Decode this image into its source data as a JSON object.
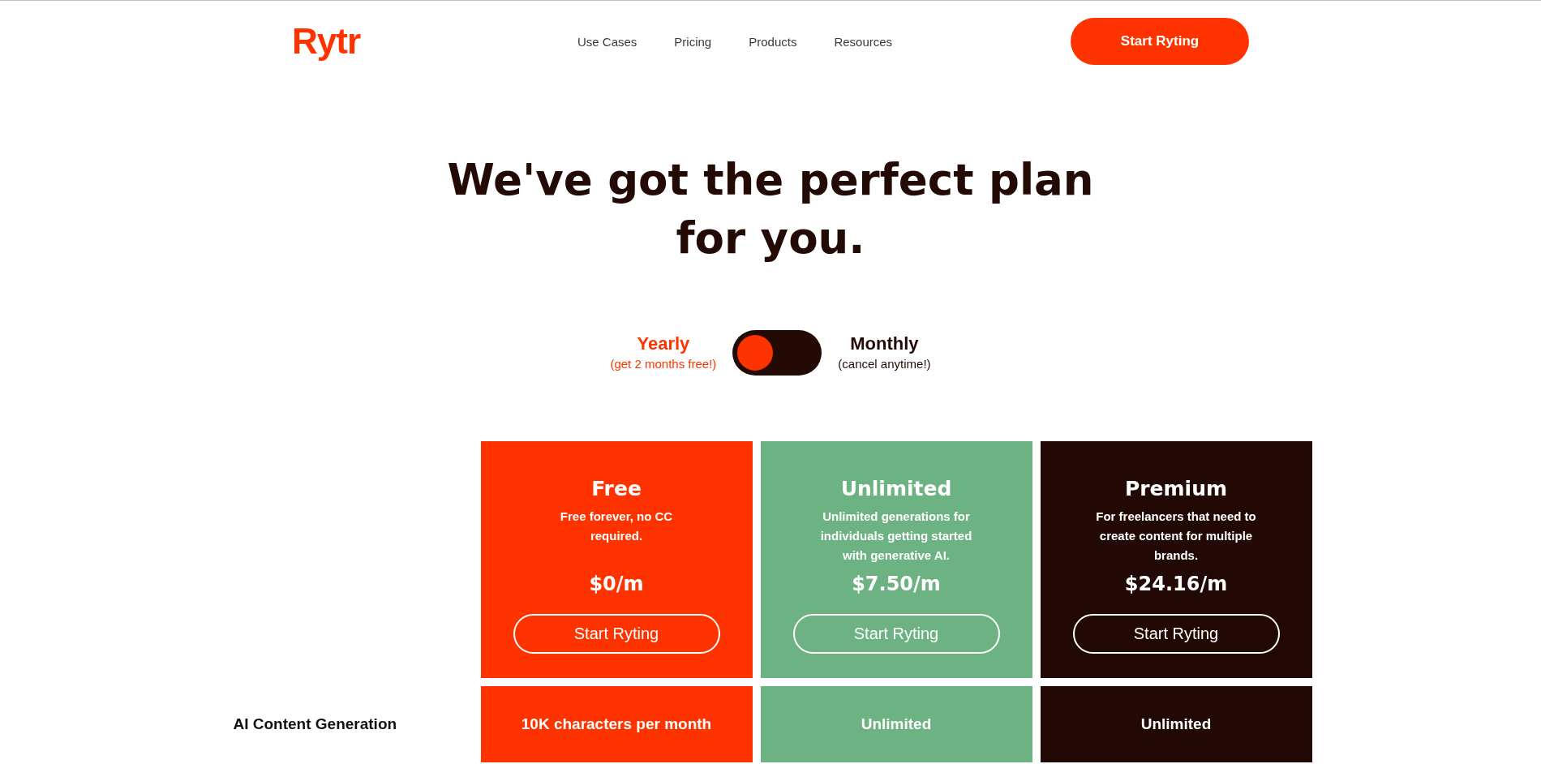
{
  "header": {
    "logo": "Rytr",
    "nav": [
      "Use Cases",
      "Pricing",
      "Products",
      "Resources"
    ],
    "cta": "Start Ryting"
  },
  "hero": {
    "title": "We've got the perfect plan for you."
  },
  "billing_toggle": {
    "options": [
      {
        "label": "Yearly",
        "note": "(get 2 months free!)",
        "selected": true
      },
      {
        "label": "Monthly",
        "note": "(cancel anytime!)",
        "selected": false
      }
    ]
  },
  "plans": [
    {
      "name": "Free",
      "description": "Free forever, no CC required.",
      "price": "$0/m",
      "button": "Start Ryting",
      "color": "#ff3300"
    },
    {
      "name": "Unlimited",
      "description": "Unlimited generations for individuals getting started with generative AI.",
      "price": "$7.50/m",
      "button": "Start Ryting",
      "color": "#6db283"
    },
    {
      "name": "Premium",
      "description": "For freelancers that need to create content for multiple brands.",
      "price": "$24.16/m",
      "button": "Start Ryting",
      "color": "#220905"
    }
  ],
  "features": [
    {
      "name": "AI Content Generation",
      "values": [
        "10K characters per month",
        "Unlimited",
        "Unlimited"
      ]
    }
  ]
}
